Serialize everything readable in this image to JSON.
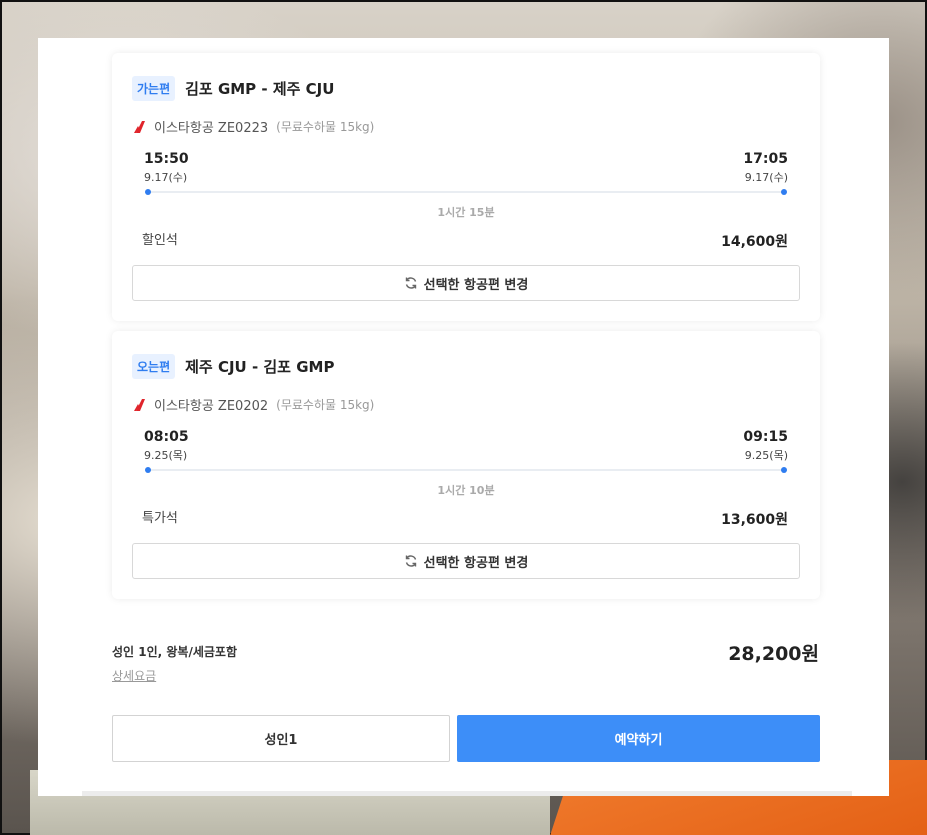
{
  "colors": {
    "accent": "#3d8ef8",
    "badge_bg": "#e8f1ff",
    "badge_text": "#2f7df0",
    "airline_red": "#e0242b"
  },
  "outbound": {
    "badge": "가는편",
    "route": "김포 GMP - 제주 CJU",
    "airline_icon": "airplane-tail-icon",
    "airline": "이스타항공 ZE0223",
    "baggage": "(무료수하물 15kg)",
    "dep_time": "15:50",
    "dep_date": "9.17(수)",
    "arr_time": "17:05",
    "arr_date": "9.17(수)",
    "duration": "1시간 15분",
    "seat_class": "할인석",
    "price": "14,600원",
    "change_label": "선택한 항공편 변경"
  },
  "inbound": {
    "badge": "오는편",
    "route": "제주 CJU - 김포 GMP",
    "airline_icon": "airplane-tail-icon",
    "airline": "이스타항공 ZE0202",
    "baggage": "(무료수하물 15kg)",
    "dep_time": "08:05",
    "dep_date": "9.25(목)",
    "arr_time": "09:15",
    "arr_date": "9.25(목)",
    "duration": "1시간 10분",
    "seat_class": "특가석",
    "price": "13,600원",
    "change_label": "선택한 항공편 변경"
  },
  "summary": {
    "label": "성인 1인, 왕복/세금포함",
    "detail_link": "상세요금",
    "total": "28,200원"
  },
  "actions": {
    "passengers": "성인1",
    "book": "예약하기"
  }
}
